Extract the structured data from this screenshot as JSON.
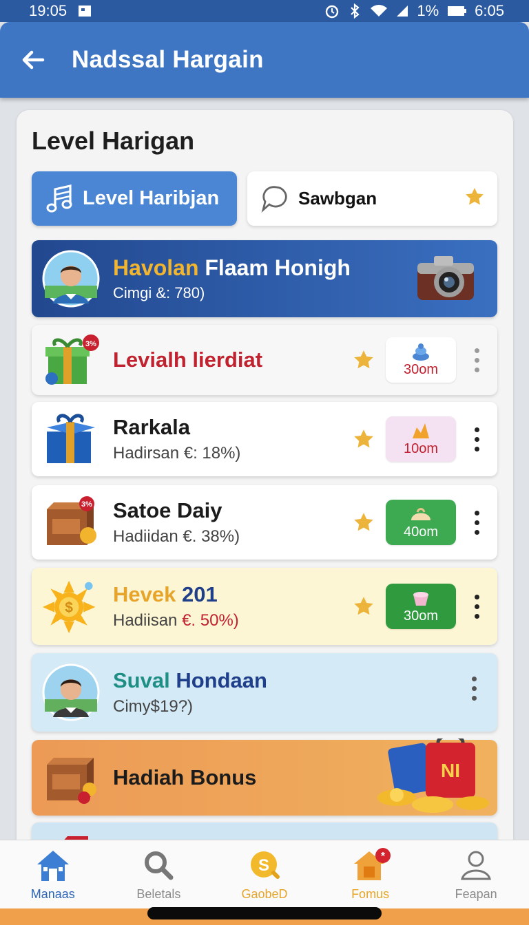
{
  "status_bar": {
    "time": "19:05",
    "battery": "1%",
    "clock": "6:05"
  },
  "app_bar": {
    "title": "Nadssal Hargain"
  },
  "section": {
    "title": "Level Harigan"
  },
  "tabs": [
    {
      "label": "Level Haribjan",
      "active": true
    },
    {
      "label": "Sawbgan",
      "active": false
    }
  ],
  "featured": {
    "name_part1": "Havolan",
    "name_part2": " Flaam Honigh",
    "sub": "Cimgi &: 780)"
  },
  "items": [
    {
      "title": "Levialh lierdiat",
      "badge": "3%",
      "pill": "30om"
    },
    {
      "title": "Rarkala",
      "sub": "Hadirsan €: 18%)",
      "pill": "10om"
    },
    {
      "title": "Satoe Daiy",
      "sub": "Hadiidan €. 38%)",
      "badge": "3%",
      "pill": "40om"
    },
    {
      "title_part1": "Hevek",
      "title_part2": " 201",
      "sub_part1": "Hadiisan ",
      "sub_part2": "€. 50%)",
      "pill": "30om"
    },
    {
      "title_part1": "Suval",
      "title_part2": " Hondaan",
      "sub": "Cimy$19?)"
    },
    {
      "title": "Hadiah Bonus"
    }
  ],
  "nav": [
    {
      "label": "Manaas",
      "icon": "house-icon",
      "active": true
    },
    {
      "label": "Beletals",
      "icon": "search-icon"
    },
    {
      "label": "GaobeD",
      "icon": "coin-icon"
    },
    {
      "label": "Fomus",
      "icon": "store-icon"
    },
    {
      "label": "Feapan",
      "icon": "profile-icon"
    }
  ],
  "colors": {
    "primary": "#3f76c4",
    "accent_gold": "#e6a52a",
    "red": "#c8202e",
    "green": "#3daa52"
  }
}
